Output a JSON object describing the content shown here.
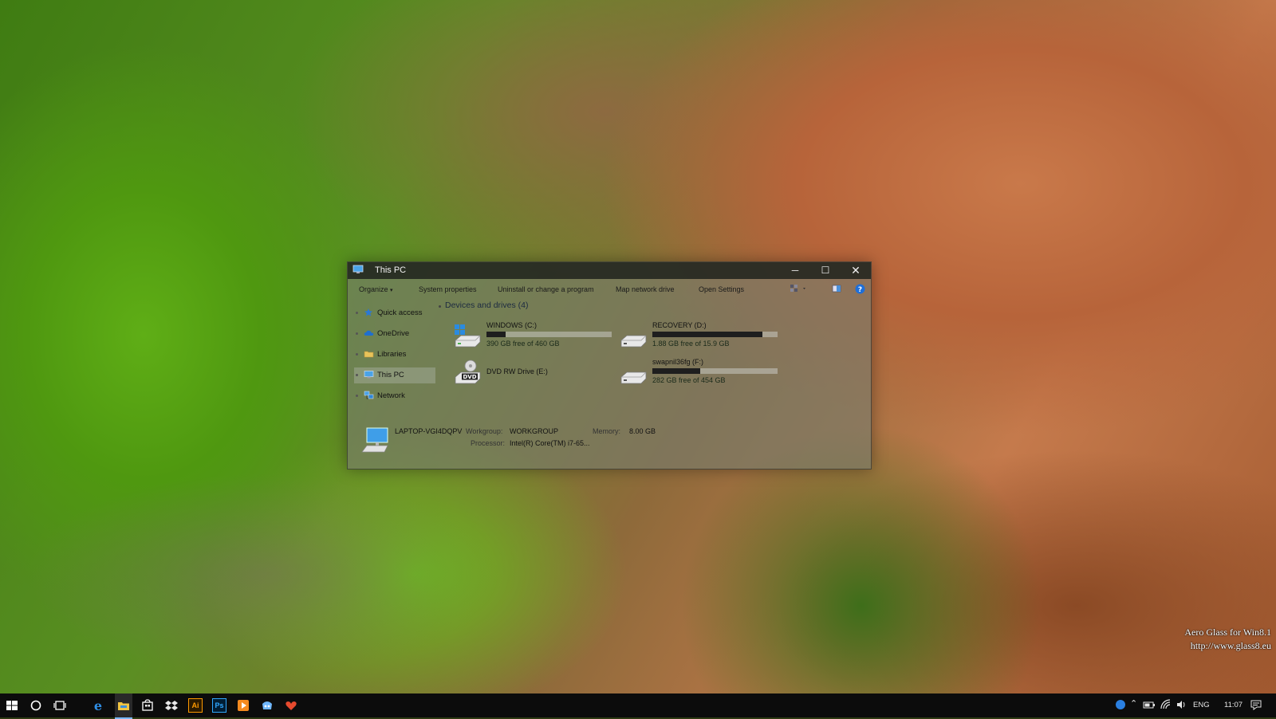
{
  "window": {
    "title": "This PC",
    "controls": {
      "minimize": "─",
      "maximize": "☐",
      "close": "✕"
    }
  },
  "toolbar": {
    "organize": "Organize",
    "system_properties": "System properties",
    "uninstall": "Uninstall or change a program",
    "map_drive": "Map network drive",
    "open_settings": "Open Settings"
  },
  "nav": {
    "items": [
      {
        "label": "Quick access",
        "icon": "star-icon"
      },
      {
        "label": "OneDrive",
        "icon": "cloud-icon"
      },
      {
        "label": "Libraries",
        "icon": "folder-icon"
      },
      {
        "label": "This PC",
        "icon": "computer-icon",
        "selected": true
      },
      {
        "label": "Network",
        "icon": "network-icon"
      }
    ]
  },
  "content": {
    "group_title": "Devices and drives (4)",
    "drives": [
      {
        "name": "WINDOWS (C:)",
        "free": "390 GB free of 460 GB",
        "used_fraction": 0.15,
        "icon": "windows-drive-icon"
      },
      {
        "name": "RECOVERY (D:)",
        "free": "1.88 GB free of 15.9 GB",
        "used_fraction": 0.88,
        "icon": "drive-icon"
      },
      {
        "name": "DVD RW Drive (E:)",
        "icon": "dvd-icon",
        "dvd_label": "DVD"
      },
      {
        "name": "swapnil36fg (F:)",
        "free": "282 GB free of 454 GB",
        "used_fraction": 0.38,
        "icon": "drive-icon"
      }
    ]
  },
  "details": {
    "computer_name": "LAPTOP-VGI4DQPV",
    "workgroup_label": "Workgroup:",
    "workgroup": "WORKGROUP",
    "memory_label": "Memory:",
    "memory": "8.00 GB",
    "processor_label": "Processor:",
    "processor": "Intel(R) Core(TM) i7-65..."
  },
  "watermark": {
    "line1": "Aero Glass for Win8.1",
    "line2": "http://www.glass8.eu"
  },
  "taskbar": {
    "ai_label": "Ai",
    "ps_label": "Ps",
    "lang": "ENG",
    "time": "11:07"
  }
}
